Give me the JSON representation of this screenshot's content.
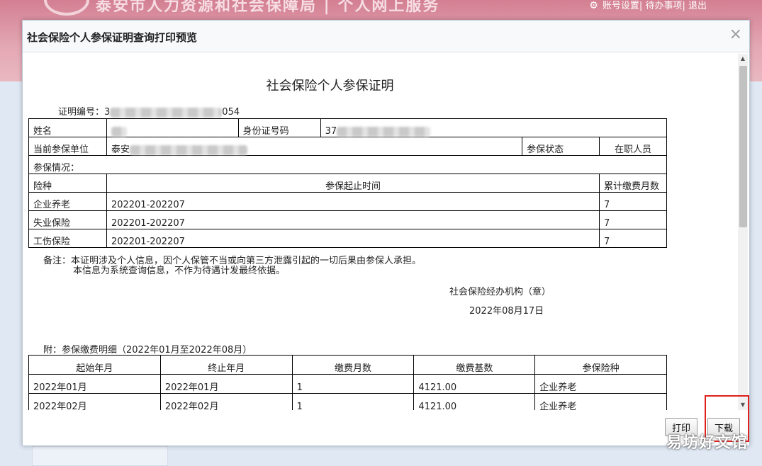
{
  "portal": {
    "site_title": "泰安市人力资源和社会保障局 | 个人网上服务",
    "nav": [
      "账号设置",
      "待办事项",
      "退出"
    ]
  },
  "dialog": {
    "title": "社会保险个人参保证明查询打印预览",
    "close_symbol": "×"
  },
  "document": {
    "title": "社会保险个人参保证明",
    "cert_no_label": "证明编号：",
    "cert_no_prefix": "3",
    "cert_no_suffix": "054",
    "name_label": "姓名",
    "id_label": "身份证号码",
    "id_prefix": "37",
    "unit_label": "当前参保单位",
    "unit_prefix": "泰安",
    "status_label": "参保状态",
    "status_value": "在职人员",
    "situation_label": "参保情况：",
    "coverage_headers": [
      "险种",
      "参保起止时间",
      "累计缴费月数"
    ],
    "coverage_rows": [
      {
        "type": "企业养老",
        "period": "202201-202207",
        "months": "7"
      },
      {
        "type": "失业保险",
        "period": "202201-202207",
        "months": "7"
      },
      {
        "type": "工伤保险",
        "period": "202201-202207",
        "months": "7"
      }
    ],
    "note_line1": "备注：本证明涉及个人信息，因个人保管不当或向第三方泄露引起的一切后果由参保人承担。",
    "note_line2": "本信息为系统查询信息，不作为待遇计发最终依据。",
    "org": "社会保险经办机构（章）",
    "date": "2022年08月17日",
    "detail_caption": "附：参保缴费明细（2022年01月至2022年08月）",
    "detail_headers": [
      "起始年月",
      "终止年月",
      "缴费月数",
      "缴费基数",
      "参保险种"
    ],
    "detail_rows": [
      {
        "start": "2022年01月",
        "end": "2022年01月",
        "months": "1",
        "base": "4121.00",
        "type": "企业养老"
      },
      {
        "start": "2022年02月",
        "end": "2022年02月",
        "months": "1",
        "base": "4121.00",
        "type": "企业养老"
      }
    ]
  },
  "buttons": {
    "print": "打印",
    "download": "下载"
  },
  "watermark": "易坊好文馆",
  "colors": {
    "highlight": "#e0201c",
    "top_band": "#d37f92"
  }
}
